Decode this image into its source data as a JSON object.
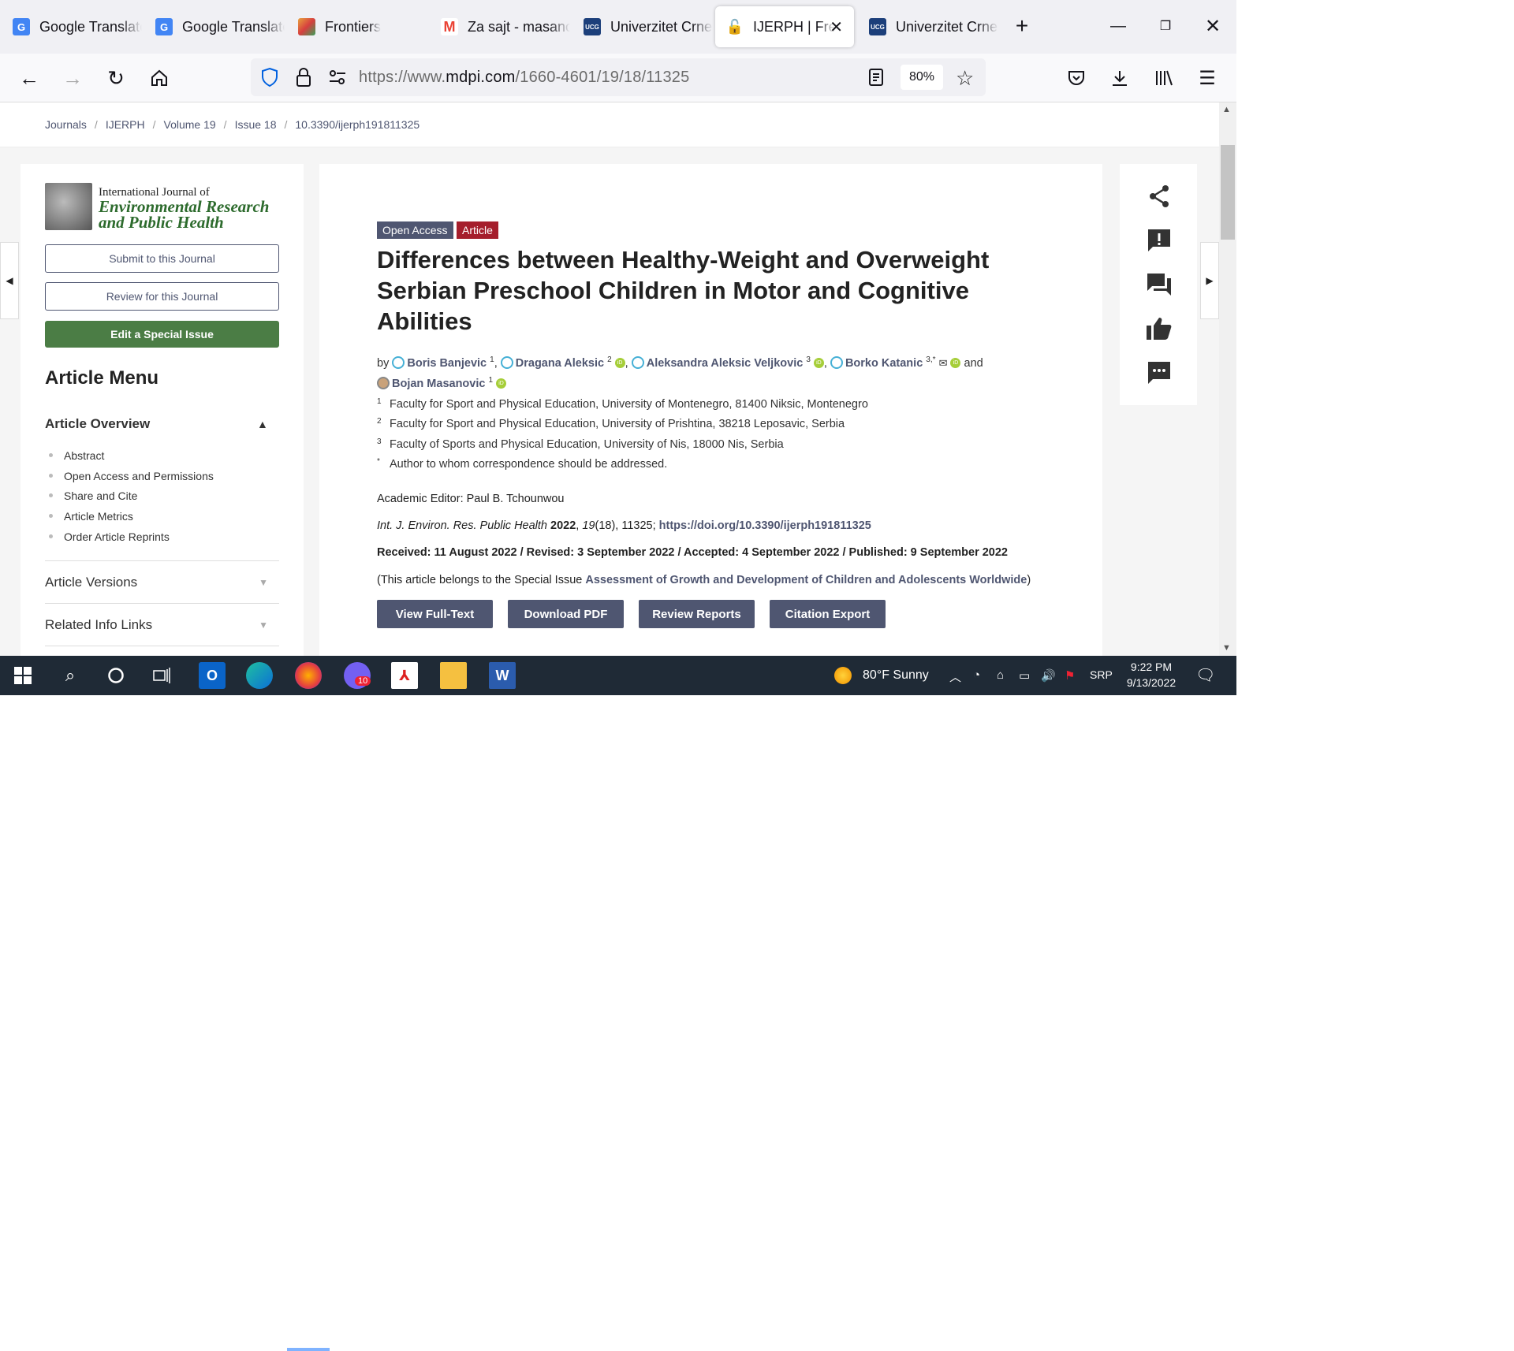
{
  "browser": {
    "tabs": [
      {
        "title": "Google Translate",
        "icon": "google-translate-icon",
        "color": "#4285f4"
      },
      {
        "title": "Google Translate",
        "icon": "google-translate-icon",
        "color": "#4285f4"
      },
      {
        "title": "Frontiers",
        "icon": "frontiers-icon",
        "color": "#e8a33d"
      },
      {
        "title": "Za sajt - masanovic",
        "icon": "gmail-icon",
        "color": "#ea4335"
      },
      {
        "title": "Univerzitet Crne Gore",
        "icon": "ucg-icon",
        "color": "#1c3f7a"
      },
      {
        "title": "IJERPH | Free Full-Text",
        "icon": "lock-open-icon",
        "color": "#15141a"
      },
      {
        "title": "Univerzitet Crne Gore",
        "icon": "ucg-icon",
        "color": "#1c3f7a"
      }
    ],
    "new_tab": "+",
    "url_prefix": "https://www.",
    "url_domain": "mdpi.com",
    "url_path": "/1660-4601/19/18/11325",
    "zoom": "80%"
  },
  "breadcrumb": {
    "items": [
      "Journals",
      "IJERPH",
      "Volume 19",
      "Issue 18",
      "10.3390/ijerph191811325"
    ],
    "sep": "/"
  },
  "journal": {
    "line1": "International Journal of",
    "line2": "Environmental Research",
    "line3": "and Public Health"
  },
  "left": {
    "submit": "Submit to this Journal",
    "review": "Review for this Journal",
    "edit": "Edit a Special Issue",
    "menu_title": "Article Menu",
    "overview_title": "Article Overview",
    "overview_items": [
      "Abstract",
      "Open Access and Permissions",
      "Share and Cite",
      "Article Metrics",
      "Order Article Reprints"
    ],
    "versions": "Article Versions",
    "related": "Related Info Links"
  },
  "article": {
    "badge_open": "Open Access",
    "badge_type": "Article",
    "title": "Differences between Healthy-Weight and Overweight Serbian Preschool Children in Motor and Cognitive Abilities",
    "by": "by",
    "and": "and",
    "authors": [
      {
        "name": "Boris Banjevic",
        "sup": "1"
      },
      {
        "name": "Dragana Aleksic",
        "sup": "2"
      },
      {
        "name": "Aleksandra Aleksic Veljkovic",
        "sup": "3"
      },
      {
        "name": "Borko Katanic",
        "sup": "3,*"
      },
      {
        "name": "Bojan Masanovic",
        "sup": "1"
      }
    ],
    "affiliations": [
      {
        "sup": "1",
        "text": "Faculty for Sport and Physical Education, University of Montenegro, 81400 Niksic, Montenegro"
      },
      {
        "sup": "2",
        "text": "Faculty for Sport and Physical Education, University of Prishtina, 38218 Leposavic, Serbia"
      },
      {
        "sup": "3",
        "text": "Faculty of Sports and Physical Education, University of Nis, 18000 Nis, Serbia"
      },
      {
        "sup": "*",
        "text": "Author to whom correspondence should be addressed."
      }
    ],
    "editor": "Academic Editor: Paul B. Tchounwou",
    "journal_abbr": "Int. J. Environ. Res. Public Health",
    "year": "2022",
    "volume": "19",
    "issue_pages": "(18), 11325; ",
    "doi_link": "https://doi.org/10.3390/ijerph191811325",
    "dates": "Received: 11 August 2022 / Revised: 3 September 2022 / Accepted: 4 September 2022 / Published: 9 September 2022",
    "special_prefix": "(This article belongs to the Special Issue ",
    "special_link": "Assessment of Growth and Development of Children and Adolescents Worldwide",
    "special_suffix": ")",
    "buttons": [
      "View Full-Text",
      "Download PDF",
      "Review Reports",
      "Citation Export"
    ]
  },
  "taskbar": {
    "weather": "80°F  Sunny",
    "lang": "SRP",
    "time": "9:22 PM",
    "date": "9/13/2022",
    "viber_count": "10"
  },
  "colors": {
    "mdpi_blue": "#4f5671",
    "green": "#4b7d45",
    "article_red": "#a51e2c"
  }
}
